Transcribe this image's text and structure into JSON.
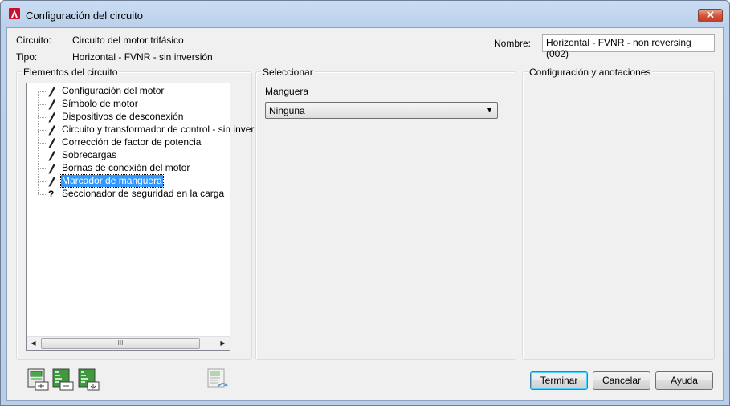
{
  "window": {
    "title": "Configuración del circuito",
    "app_icon": "autocad-a-icon",
    "close_icon": "close-icon"
  },
  "header": {
    "circuito_label": "Circuito:",
    "circuito_value": "Circuito del motor trifásico",
    "tipo_label": "Tipo:",
    "tipo_value": "Horizontal - FVNR - sin inversión",
    "nombre_label": "Nombre:",
    "nombre_value": "Horizontal - FVNR - non reversing (002)"
  },
  "elements_panel": {
    "title": "Elementos del circuito",
    "items": [
      {
        "label": "Configuración del motor",
        "icon": "pencil-icon"
      },
      {
        "label": "Símbolo de motor",
        "icon": "pencil-icon"
      },
      {
        "label": "Dispositivos de desconexión",
        "icon": "pencil-icon"
      },
      {
        "label": "Circuito y transformador de control - sin inver",
        "icon": "pencil-icon"
      },
      {
        "label": "Corrección de factor de potencia",
        "icon": "pencil-icon"
      },
      {
        "label": "Sobrecargas",
        "icon": "pencil-icon"
      },
      {
        "label": "Bornas de conexión del motor",
        "icon": "pencil-icon"
      },
      {
        "label": "Marcador de manguera",
        "icon": "pencil-icon",
        "selected": true
      },
      {
        "label": "Seccionador de seguridad en la carga",
        "icon": "question-icon"
      }
    ],
    "scroll_thumb_glyph": "III"
  },
  "select_panel": {
    "title": "Seleccionar",
    "field_label": "Manguera",
    "field_value": "Ninguna"
  },
  "config_panel": {
    "title": "Configuración y anotaciones"
  },
  "footer": {
    "tool_icons": [
      "insert-circuit-icon",
      "save-circuit-icon",
      "export-circuit-icon",
      "restore-circuit-icon"
    ],
    "terminar": "Terminar",
    "cancelar": "Cancelar",
    "ayuda": "Ayuda"
  },
  "colors": {
    "selection": "#3399ff",
    "title_bar": "#bcd2ec",
    "close_button": "#c43a22"
  }
}
